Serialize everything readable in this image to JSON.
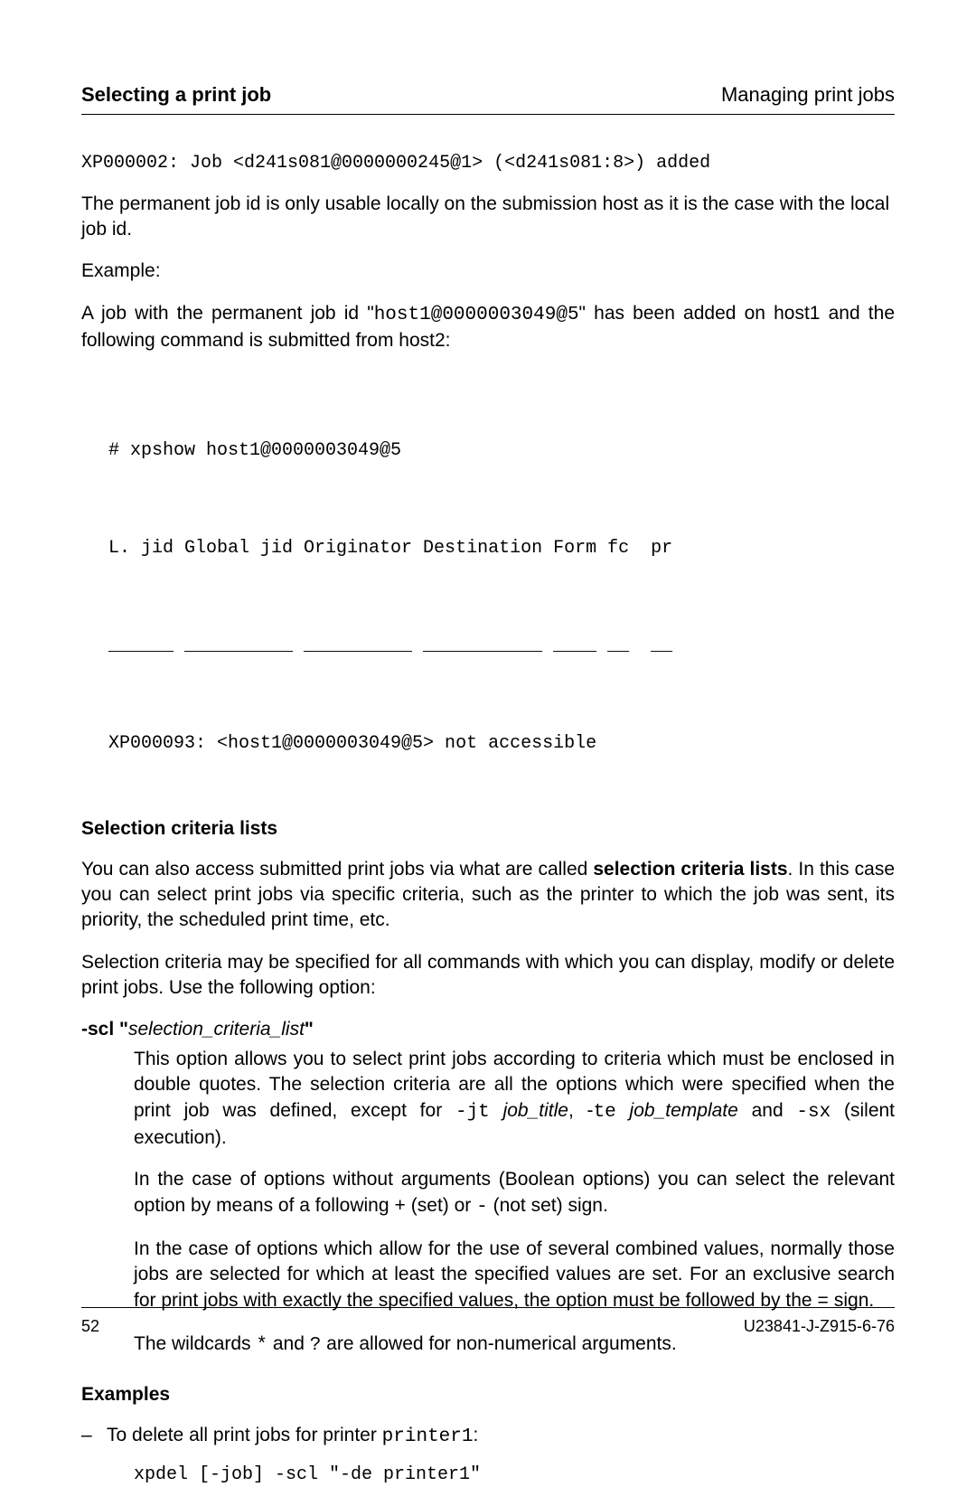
{
  "header": {
    "left": "Selecting a print job",
    "right": "Managing print jobs"
  },
  "line1": "XP000002: Job <d241s081@0000000245@1> (<d241s081:8>) added",
  "para1": "The permanent job id is only usable locally on the submission host as it is the case with the local job id.",
  "example_label": "Example:",
  "para2_a": "A job with the permanent job id \"",
  "para2_code": "host1@0000003049@5",
  "para2_b": "\" has been added on host1 and the following command is submitted from host2:",
  "code": {
    "l1": "# xpshow host1@0000003049@5",
    "l2": "L. jid Global jid Originator Destination Form fc  pr",
    "l3": "______ __________ __________ ___________ ____ __  __",
    "l4": "XP000093: <host1@0000003049@5> not accessible"
  },
  "sel_heading": "Selection criteria lists",
  "sel_p1_a": "You can also access submitted print jobs via what are called ",
  "sel_p1_bold": "selection criteria lists",
  "sel_p1_b": ". In this case you can select print jobs via specific criteria, such as the printer to which the job was sent, its priority, the scheduled print time, etc.",
  "sel_p2": "Selection criteria may be specified for all commands with which you can display, modify or delete print jobs. Use the following option:",
  "scl": {
    "flag": "-scl",
    "open_q": " \"",
    "arg": "selection_criteria_list",
    "close_q": "\"",
    "p1_a": "This option allows you to select print jobs according to criteria which must be enclosed in double quotes. The selection criteria are all the options which were specified when the print job was defined, except for ",
    "jt": "-jt",
    "job_title": "job_title",
    "sep1": ", -",
    "te": "te",
    "job_template": " job_template",
    "and": "  and  ",
    "sx": "-sx",
    "p1_b": " (silent execution).",
    "p2_a": "In the case of options without arguments (Boolean options) you can select the relevant option by means of a following ",
    "plus": "+",
    "p2_b": " (set) or ",
    "minus": "-",
    "p2_c": " (not set) sign.",
    "p3_a": "In the case of options which allow for the use of several combined values, normally those jobs are selected for which at least the specified values are set. For an exclusive search for print jobs with exactly the specified values, the option must be followed by the ",
    "eq": "=",
    "p3_b": " sign.",
    "p4_a": "The wildcards ",
    "star": "*",
    "p4_b": " and ",
    "qmark": "?",
    "p4_c": " are allowed for non-numerical arguments."
  },
  "examples_heading": "Examples",
  "ex1_a": "To delete all print jobs for printer ",
  "ex1_code": "printer1",
  "ex1_b": ":",
  "ex1_cmd": "xpdel [-job] -scl \"-de printer1\"",
  "footer": {
    "page": "52",
    "docid": "U23841-J-Z915-6-76"
  }
}
